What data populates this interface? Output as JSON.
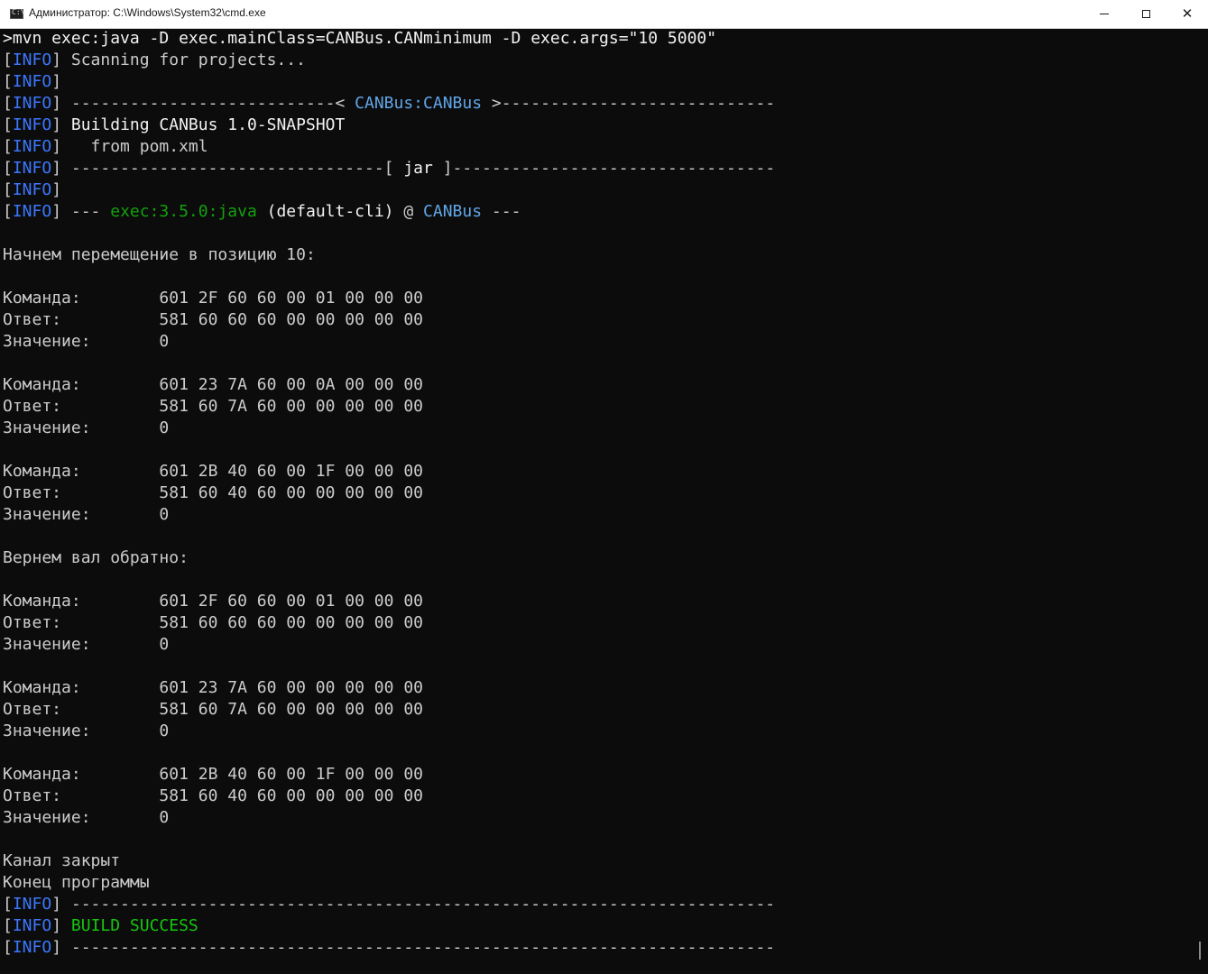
{
  "window": {
    "title": "Администратор: C:\\Windows\\System32\\cmd.exe",
    "icon": "cmd-console-icon",
    "controls": {
      "minimize": "minimize-icon",
      "maximize": "maximize-icon",
      "close": "close-icon",
      "close_glyph": "✕"
    }
  },
  "colors": {
    "background": "#0c0c0c",
    "text": "#cccccc",
    "bright_text": "#f2f2f2",
    "info_blue": "#3b78ff",
    "project_cyan": "#61a6e8",
    "success_green": "#16c60c",
    "plugin_green": "#13a10e"
  },
  "console": {
    "lines": [
      [
        {
          "t": ">mvn exec:java -D exec.mainClass=CANBus.CANminimum -D exec.args=\"10 5000\"",
          "c": "bright"
        }
      ],
      [
        {
          "t": "[",
          "c": "default"
        },
        {
          "t": "INFO",
          "c": "blue"
        },
        {
          "t": "] Scanning for projects...",
          "c": "default"
        }
      ],
      [
        {
          "t": "[",
          "c": "default"
        },
        {
          "t": "INFO",
          "c": "blue"
        },
        {
          "t": "]",
          "c": "default"
        }
      ],
      [
        {
          "t": "[",
          "c": "default"
        },
        {
          "t": "INFO",
          "c": "blue"
        },
        {
          "t": "] ---------------------------< ",
          "c": "default"
        },
        {
          "t": "CANBus:CANBus",
          "c": "cyan"
        },
        {
          "t": " >----------------------------",
          "c": "default"
        }
      ],
      [
        {
          "t": "[",
          "c": "default"
        },
        {
          "t": "INFO",
          "c": "blue"
        },
        {
          "t": "] ",
          "c": "default"
        },
        {
          "t": "Building CANBus 1.0-SNAPSHOT",
          "c": "bright"
        }
      ],
      [
        {
          "t": "[",
          "c": "default"
        },
        {
          "t": "INFO",
          "c": "blue"
        },
        {
          "t": "]   from pom.xml",
          "c": "default"
        }
      ],
      [
        {
          "t": "[",
          "c": "default"
        },
        {
          "t": "INFO",
          "c": "blue"
        },
        {
          "t": "] --------------------------------[ ",
          "c": "default"
        },
        {
          "t": "jar",
          "c": "bright"
        },
        {
          "t": " ]---------------------------------",
          "c": "default"
        }
      ],
      [
        {
          "t": "[",
          "c": "default"
        },
        {
          "t": "INFO",
          "c": "blue"
        },
        {
          "t": "]",
          "c": "default"
        }
      ],
      [
        {
          "t": "[",
          "c": "default"
        },
        {
          "t": "INFO",
          "c": "blue"
        },
        {
          "t": "] --- ",
          "c": "default"
        },
        {
          "t": "exec:3.5.0:java",
          "c": "dgreen"
        },
        {
          "t": " (default-cli)",
          "c": "bright"
        },
        {
          "t": " @ ",
          "c": "default"
        },
        {
          "t": "CANBus",
          "c": "cyan"
        },
        {
          "t": " ---",
          "c": "default"
        }
      ],
      [
        {
          "t": "",
          "c": "default"
        }
      ],
      [
        {
          "t": "Начнем перемещение в позицию 10:",
          "c": "default"
        }
      ],
      [
        {
          "t": "",
          "c": "default"
        }
      ],
      [
        {
          "t": "Команда:        601 2F 60 60 00 01 00 00 00",
          "c": "default"
        }
      ],
      [
        {
          "t": "Ответ:          581 60 60 60 00 00 00 00 00",
          "c": "default"
        }
      ],
      [
        {
          "t": "Значение:       0",
          "c": "default"
        }
      ],
      [
        {
          "t": "",
          "c": "default"
        }
      ],
      [
        {
          "t": "Команда:        601 23 7A 60 00 0A 00 00 00",
          "c": "default"
        }
      ],
      [
        {
          "t": "Ответ:          581 60 7A 60 00 00 00 00 00",
          "c": "default"
        }
      ],
      [
        {
          "t": "Значение:       0",
          "c": "default"
        }
      ],
      [
        {
          "t": "",
          "c": "default"
        }
      ],
      [
        {
          "t": "Команда:        601 2B 40 60 00 1F 00 00 00",
          "c": "default"
        }
      ],
      [
        {
          "t": "Ответ:          581 60 40 60 00 00 00 00 00",
          "c": "default"
        }
      ],
      [
        {
          "t": "Значение:       0",
          "c": "default"
        }
      ],
      [
        {
          "t": "",
          "c": "default"
        }
      ],
      [
        {
          "t": "Вернем вал обратно:",
          "c": "default"
        }
      ],
      [
        {
          "t": "",
          "c": "default"
        }
      ],
      [
        {
          "t": "Команда:        601 2F 60 60 00 01 00 00 00",
          "c": "default"
        }
      ],
      [
        {
          "t": "Ответ:          581 60 60 60 00 00 00 00 00",
          "c": "default"
        }
      ],
      [
        {
          "t": "Значение:       0",
          "c": "default"
        }
      ],
      [
        {
          "t": "",
          "c": "default"
        }
      ],
      [
        {
          "t": "Команда:        601 23 7A 60 00 00 00 00 00",
          "c": "default"
        }
      ],
      [
        {
          "t": "Ответ:          581 60 7A 60 00 00 00 00 00",
          "c": "default"
        }
      ],
      [
        {
          "t": "Значение:       0",
          "c": "default"
        }
      ],
      [
        {
          "t": "",
          "c": "default"
        }
      ],
      [
        {
          "t": "Команда:        601 2B 40 60 00 1F 00 00 00",
          "c": "default"
        }
      ],
      [
        {
          "t": "Ответ:          581 60 40 60 00 00 00 00 00",
          "c": "default"
        }
      ],
      [
        {
          "t": "Значение:       0",
          "c": "default"
        }
      ],
      [
        {
          "t": "",
          "c": "default"
        }
      ],
      [
        {
          "t": "Канал закрыт",
          "c": "default"
        }
      ],
      [
        {
          "t": "Конец программы",
          "c": "default"
        }
      ],
      [
        {
          "t": "[",
          "c": "default"
        },
        {
          "t": "INFO",
          "c": "blue"
        },
        {
          "t": "] ------------------------------------------------------------------------",
          "c": "default"
        }
      ],
      [
        {
          "t": "[",
          "c": "default"
        },
        {
          "t": "INFO",
          "c": "blue"
        },
        {
          "t": "] ",
          "c": "default"
        },
        {
          "t": "BUILD SUCCESS",
          "c": "green"
        }
      ],
      [
        {
          "t": "[",
          "c": "default"
        },
        {
          "t": "INFO",
          "c": "blue"
        },
        {
          "t": "] ------------------------------------------------------------------------",
          "c": "default"
        }
      ]
    ]
  }
}
